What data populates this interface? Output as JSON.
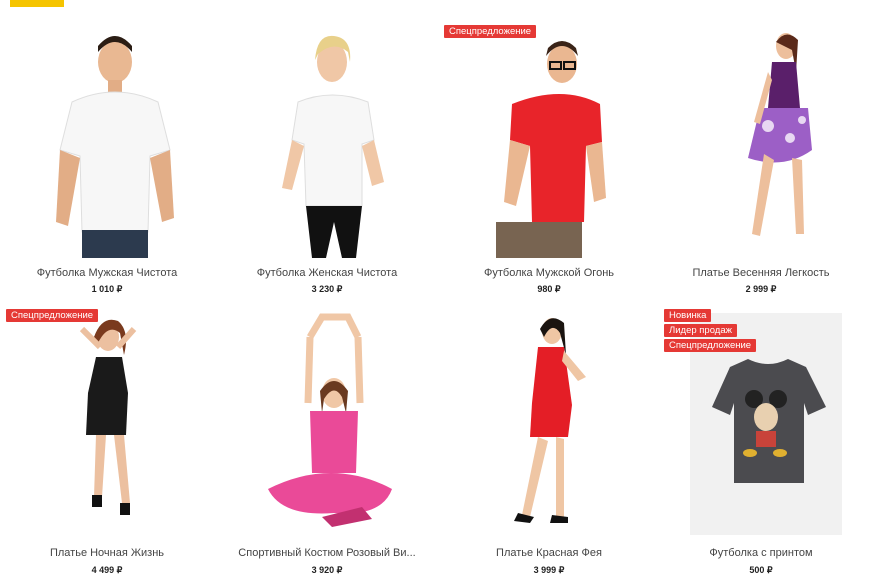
{
  "products": [
    {
      "name": "Футболка Мужская Чистота",
      "price": "1 010 ₽",
      "badges": []
    },
    {
      "name": "Футболка Женская Чистота",
      "price": "3 230 ₽",
      "badges": []
    },
    {
      "name": "Футболка Мужской Огонь",
      "price": "980 ₽",
      "badges": [
        "Спецпредложение"
      ]
    },
    {
      "name": "Платье Весенняя Легкость",
      "price": "2 999 ₽",
      "badges": []
    },
    {
      "name": "Платье Ночная Жизнь",
      "price": "4 499 ₽",
      "badges": [
        "Спецпредложение"
      ]
    },
    {
      "name": "Спортивный Костюм Розовый Ви...",
      "price": "3 920 ₽",
      "badges": []
    },
    {
      "name": "Платье Красная Фея",
      "price": "3 999 ₽",
      "badges": []
    },
    {
      "name": "Футболка с принтом",
      "price": "500 ₽",
      "badges": [
        "Новинка",
        "Лидер продаж",
        "Спецпредложение"
      ]
    }
  ],
  "colors": {
    "accent": "#f5c400",
    "badge": "#e53935"
  }
}
